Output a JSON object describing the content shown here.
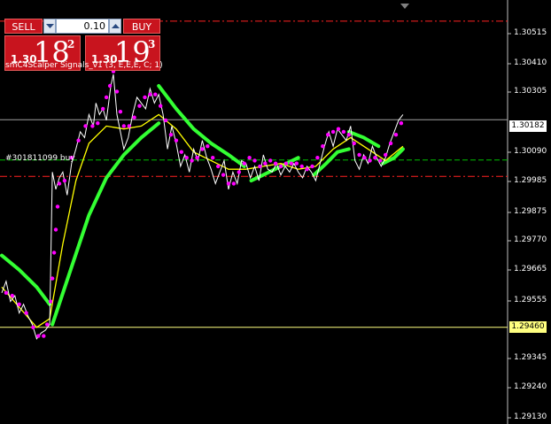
{
  "trade_panel": {
    "sell_label": "SELL",
    "buy_label": "BUY",
    "volume_value": "0.10",
    "sell_quote": {
      "big": "1.30",
      "pips": "18",
      "point": "2"
    },
    "buy_quote": {
      "big": "1.30",
      "pips": "19",
      "point": "3"
    }
  },
  "indicator_label": "smC4Scalper Signals_v1 (3, E,E,E, C; 1)",
  "order_label": "#301811099 buy",
  "price_axis": {
    "ticks": [
      "1.30515",
      "1.30410",
      "1.30305",
      "1.30090",
      "1.29985",
      "1.29875",
      "1.29770",
      "1.29665",
      "1.29555",
      "1.29345",
      "1.29240",
      "1.29130"
    ],
    "bid_price": "1.30182",
    "open_price": "1.29460"
  },
  "colors": {
    "background": "#000000",
    "price_line": "#ffffff",
    "signal_fast": "#ff00ff",
    "signal_trend": "#33ff33",
    "moving_average": "#ffff00",
    "order_level": "#00c000",
    "stop_levels": "#ff2020",
    "panel_red": "#c8141e"
  },
  "chart_data": {
    "type": "line",
    "ylim": [
      1.2913,
      1.3058
    ],
    "xlim": [
      0,
      580
    ],
    "levels": {
      "bid": 1.30182,
      "open_order": 1.2946,
      "take_profit": 1.30525,
      "stop_loss": 1.29985,
      "order_marker": 1.30042
    },
    "series": [
      {
        "key": "price",
        "points": [
          [
            0,
            1.2958
          ],
          [
            5,
            1.2962
          ],
          [
            10,
            1.2955
          ],
          [
            15,
            1.2957
          ],
          [
            20,
            1.2951
          ],
          [
            25,
            1.2954
          ],
          [
            30,
            1.295
          ],
          [
            35,
            1.2947
          ],
          [
            40,
            1.2942
          ],
          [
            45,
            1.2944
          ],
          [
            50,
            1.2945
          ],
          [
            55,
            1.2947
          ],
          [
            58,
            1.3
          ],
          [
            62,
            1.2994
          ],
          [
            66,
            1.2998
          ],
          [
            70,
            1.3
          ],
          [
            75,
            1.2992
          ],
          [
            80,
            1.3003
          ],
          [
            85,
            1.3008
          ],
          [
            90,
            1.3014
          ],
          [
            95,
            1.3012
          ],
          [
            100,
            1.302
          ],
          [
            105,
            1.3016
          ],
          [
            108,
            1.3024
          ],
          [
            112,
            1.302
          ],
          [
            116,
            1.3022
          ],
          [
            120,
            1.3018
          ],
          [
            125,
            1.303
          ],
          [
            128,
            1.3034
          ],
          [
            132,
            1.302
          ],
          [
            136,
            1.3014
          ],
          [
            140,
            1.3008
          ],
          [
            145,
            1.3012
          ],
          [
            150,
            1.302
          ],
          [
            155,
            1.3026
          ],
          [
            160,
            1.3024
          ],
          [
            165,
            1.3022
          ],
          [
            170,
            1.3029
          ],
          [
            175,
            1.3024
          ],
          [
            180,
            1.3027
          ],
          [
            185,
            1.302
          ],
          [
            190,
            1.3008
          ],
          [
            195,
            1.3016
          ],
          [
            200,
            1.301
          ],
          [
            205,
            1.3002
          ],
          [
            210,
            1.3006
          ],
          [
            215,
            1.3
          ],
          [
            220,
            1.3008
          ],
          [
            225,
            1.3004
          ],
          [
            230,
            1.3011
          ],
          [
            235,
            1.3005
          ],
          [
            240,
            1.3001
          ],
          [
            245,
            1.2996
          ],
          [
            250,
            1.3
          ],
          [
            255,
            1.3004
          ],
          [
            260,
            1.2994
          ],
          [
            265,
            1.3
          ],
          [
            270,
            1.2996
          ],
          [
            275,
            1.3004
          ],
          [
            280,
            1.3003
          ],
          [
            285,
            1.2998
          ],
          [
            290,
            1.3002
          ],
          [
            295,
            1.2997
          ],
          [
            300,
            1.3006
          ],
          [
            305,
            1.3001
          ],
          [
            310,
            1.3
          ],
          [
            315,
            1.3003
          ],
          [
            320,
            1.2999
          ],
          [
            325,
            1.3002
          ],
          [
            330,
            1.3
          ],
          [
            335,
            1.3003
          ],
          [
            340,
            1.3
          ],
          [
            345,
            1.2998
          ],
          [
            350,
            1.3002
          ],
          [
            355,
            1.3
          ],
          [
            360,
            1.2997
          ],
          [
            365,
            1.3003
          ],
          [
            370,
            1.3009
          ],
          [
            375,
            1.3014
          ],
          [
            380,
            1.3009
          ],
          [
            385,
            1.3015
          ],
          [
            390,
            1.3013
          ],
          [
            395,
            1.3011
          ],
          [
            400,
            1.3016
          ],
          [
            405,
            1.3004
          ],
          [
            410,
            1.3001
          ],
          [
            415,
            1.3006
          ],
          [
            420,
            1.3003
          ],
          [
            425,
            1.3009
          ],
          [
            430,
            1.3005
          ],
          [
            435,
            1.3002
          ],
          [
            440,
            1.3005
          ],
          [
            445,
            1.301
          ],
          [
            450,
            1.3014
          ],
          [
            455,
            1.3018
          ],
          [
            460,
            1.302
          ]
        ]
      },
      {
        "key": "moving_average",
        "points": [
          [
            0,
            1.296
          ],
          [
            20,
            1.2953
          ],
          [
            40,
            1.2946
          ],
          [
            55,
            1.2949
          ],
          [
            70,
            1.2975
          ],
          [
            85,
            1.2997
          ],
          [
            100,
            1.301
          ],
          [
            120,
            1.3016
          ],
          [
            140,
            1.3015
          ],
          [
            160,
            1.3016
          ],
          [
            180,
            1.302
          ],
          [
            200,
            1.3015
          ],
          [
            220,
            1.3007
          ],
          [
            240,
            1.3004
          ],
          [
            260,
            1.3001
          ],
          [
            280,
            1.3001
          ],
          [
            300,
            1.3002
          ],
          [
            320,
            1.3003
          ],
          [
            340,
            1.3001
          ],
          [
            360,
            1.3002
          ],
          [
            380,
            1.3008
          ],
          [
            400,
            1.3012
          ],
          [
            420,
            1.3008
          ],
          [
            440,
            1.3004
          ],
          [
            460,
            1.3009
          ]
        ]
      },
      {
        "key": "trend_signal",
        "segments": [
          [
            [
              0,
              1.2971
            ],
            [
              20,
              1.2966
            ],
            [
              40,
              1.296
            ],
            [
              55,
              1.2954
            ]
          ],
          [
            [
              58,
              1.2947
            ],
            [
              80,
              1.2967
            ],
            [
              100,
              1.2985
            ],
            [
              120,
              1.2998
            ],
            [
              140,
              1.3006
            ],
            [
              160,
              1.3012
            ],
            [
              180,
              1.3017
            ]
          ],
          [
            [
              180,
              1.303
            ],
            [
              200,
              1.3022
            ],
            [
              220,
              1.3015
            ],
            [
              240,
              1.301
            ],
            [
              260,
              1.3006
            ],
            [
              278,
              1.3002
            ]
          ],
          [
            [
              286,
              1.2997
            ],
            [
              300,
              1.2999
            ],
            [
              320,
              1.3002
            ],
            [
              340,
              1.3005
            ]
          ],
          [
            [
              358,
              1.2999
            ],
            [
              372,
              1.3003
            ],
            [
              385,
              1.3007
            ],
            [
              398,
              1.3008
            ]
          ],
          [
            [
              398,
              1.3014
            ],
            [
              415,
              1.3012
            ],
            [
              432,
              1.3009
            ]
          ],
          [
            [
              437,
              1.3003
            ],
            [
              450,
              1.3005
            ],
            [
              460,
              1.3008
            ]
          ]
        ]
      },
      {
        "key": "fast_signal",
        "points": [
          [
            5,
            1.2958
          ],
          [
            12,
            1.2957
          ],
          [
            20,
            1.2954
          ],
          [
            28,
            1.2951
          ],
          [
            36,
            1.2946
          ],
          [
            42,
            1.2943
          ],
          [
            48,
            1.2943
          ],
          [
            52,
            1.2947
          ],
          [
            56,
            1.2955
          ],
          [
            58,
            1.2963
          ],
          [
            60,
            1.2972
          ],
          [
            62,
            1.298
          ],
          [
            64,
            1.2988
          ],
          [
            66,
            1.2996
          ],
          [
            72,
            1.2997
          ],
          [
            80,
            1.3005
          ],
          [
            88,
            1.3011
          ],
          [
            96,
            1.3016
          ],
          [
            104,
            1.3016
          ],
          [
            110,
            1.3017
          ],
          [
            116,
            1.3022
          ],
          [
            120,
            1.3026
          ],
          [
            124,
            1.303
          ],
          [
            128,
            1.3035
          ],
          [
            132,
            1.3028
          ],
          [
            136,
            1.3021
          ],
          [
            140,
            1.3016
          ],
          [
            146,
            1.3016
          ],
          [
            152,
            1.3019
          ],
          [
            158,
            1.3023
          ],
          [
            164,
            1.3026
          ],
          [
            170,
            1.3027
          ],
          [
            176,
            1.3027
          ],
          [
            182,
            1.3023
          ],
          [
            188,
            1.3018
          ],
          [
            194,
            1.3013
          ],
          [
            200,
            1.3011
          ],
          [
            206,
            1.3007
          ],
          [
            212,
            1.3005
          ],
          [
            218,
            1.3004
          ],
          [
            224,
            1.3005
          ],
          [
            230,
            1.3008
          ],
          [
            236,
            1.3009
          ],
          [
            242,
            1.3005
          ],
          [
            248,
            1.3002
          ],
          [
            254,
            1.2999
          ],
          [
            260,
            1.2996
          ],
          [
            266,
            1.2996
          ],
          [
            272,
            1.3
          ],
          [
            278,
            1.3003
          ],
          [
            284,
            1.3005
          ],
          [
            290,
            1.3004
          ],
          [
            296,
            1.3002
          ],
          [
            302,
            1.3003
          ],
          [
            308,
            1.3004
          ],
          [
            314,
            1.3003
          ],
          [
            320,
            1.3002
          ],
          [
            326,
            1.3003
          ],
          [
            332,
            1.3003
          ],
          [
            338,
            1.3003
          ],
          [
            344,
            1.3002
          ],
          [
            350,
            1.3001
          ],
          [
            356,
            1.3002
          ],
          [
            362,
            1.3005
          ],
          [
            368,
            1.3009
          ],
          [
            374,
            1.3013
          ],
          [
            380,
            1.3014
          ],
          [
            386,
            1.3015
          ],
          [
            392,
            1.3014
          ],
          [
            398,
            1.3013
          ],
          [
            404,
            1.301
          ],
          [
            410,
            1.3006
          ],
          [
            416,
            1.3005
          ],
          [
            422,
            1.3004
          ],
          [
            428,
            1.3005
          ],
          [
            434,
            1.3004
          ],
          [
            440,
            1.3006
          ],
          [
            446,
            1.301
          ],
          [
            452,
            1.3013
          ],
          [
            458,
            1.3017
          ]
        ]
      }
    ]
  }
}
